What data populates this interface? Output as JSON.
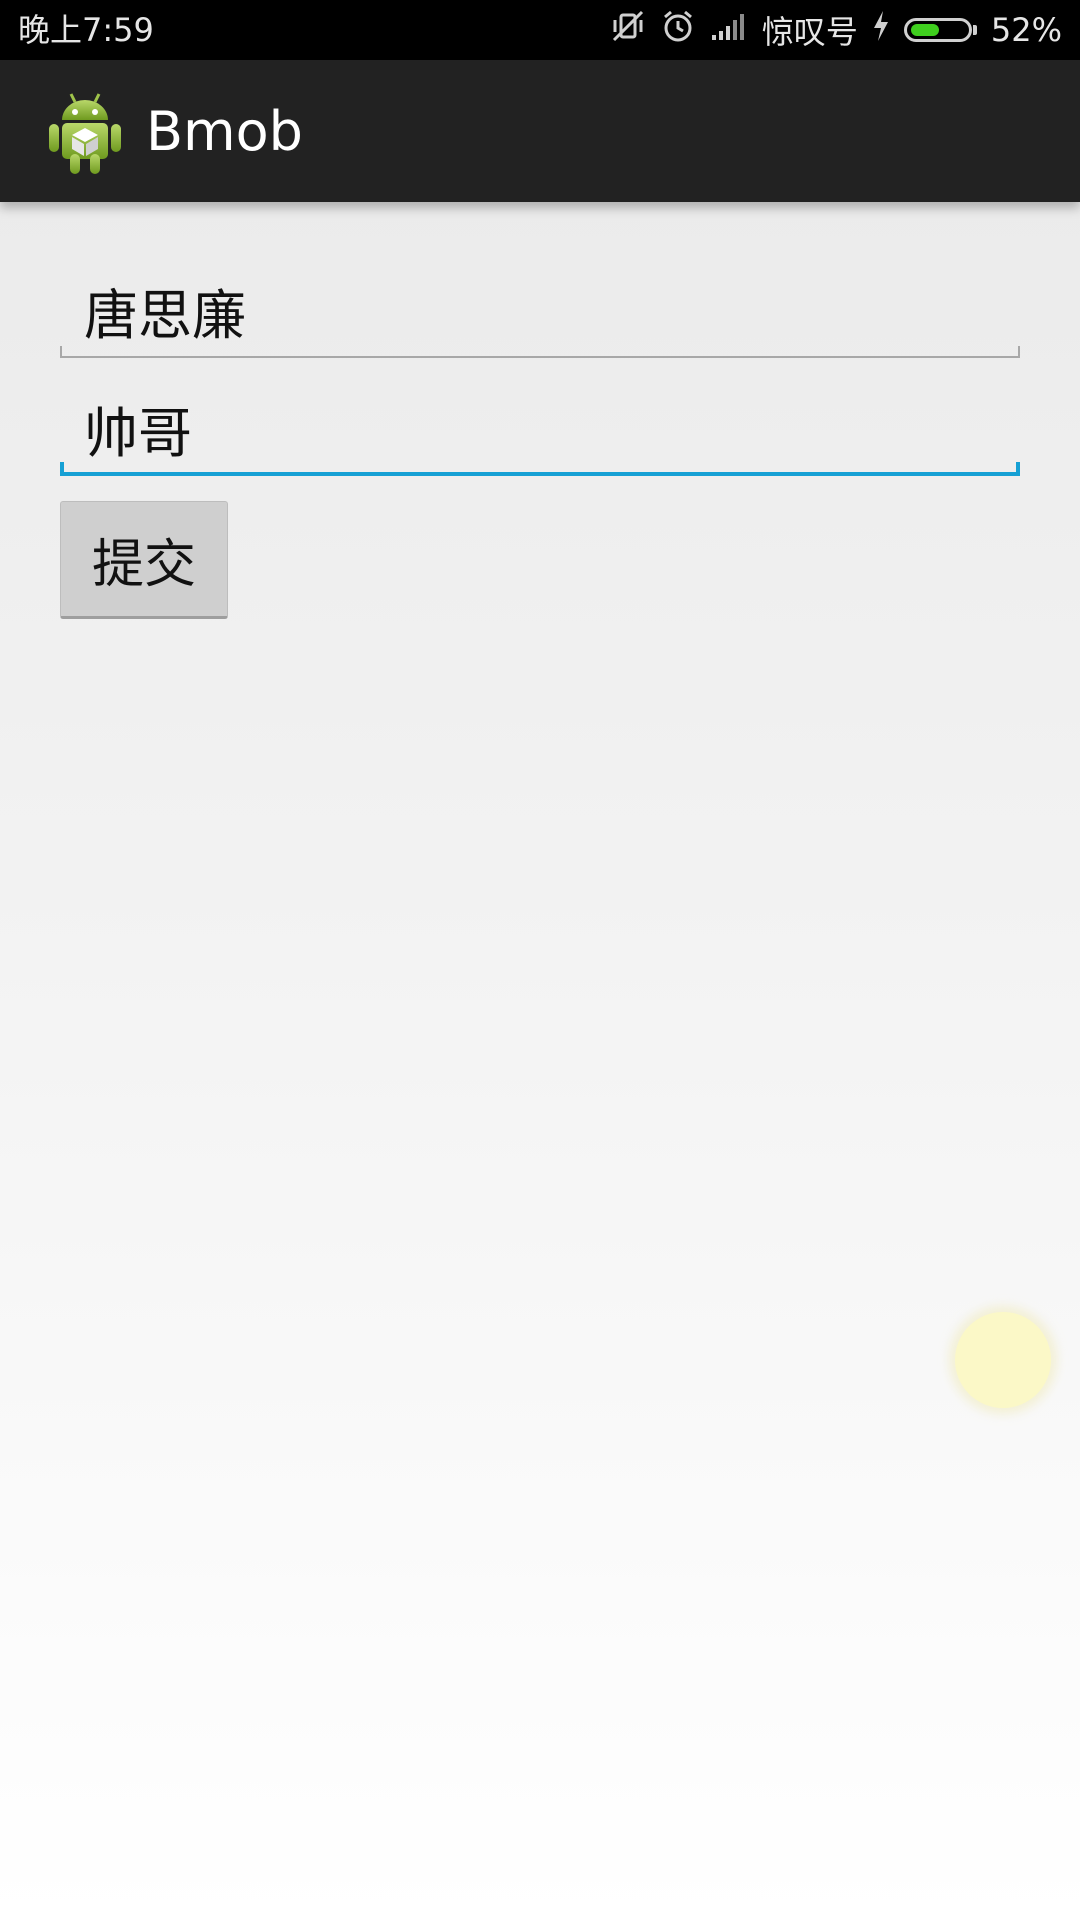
{
  "status_bar": {
    "time": "晚上7:59",
    "carrier": "惊叹号",
    "battery_percent_label": "52%",
    "battery_level": 0.52,
    "icons": [
      "vibrate-off-icon",
      "alarm-icon",
      "signal-icon",
      "charging-icon",
      "battery-icon"
    ],
    "battery_color": "#3fcf1e"
  },
  "action_bar": {
    "title": "Bmob",
    "icon": "android-app-icon"
  },
  "form": {
    "name_value": "唐思廉",
    "desc_value": "帅哥",
    "submit_label": "提交",
    "focus_color": "#16a0d4"
  }
}
